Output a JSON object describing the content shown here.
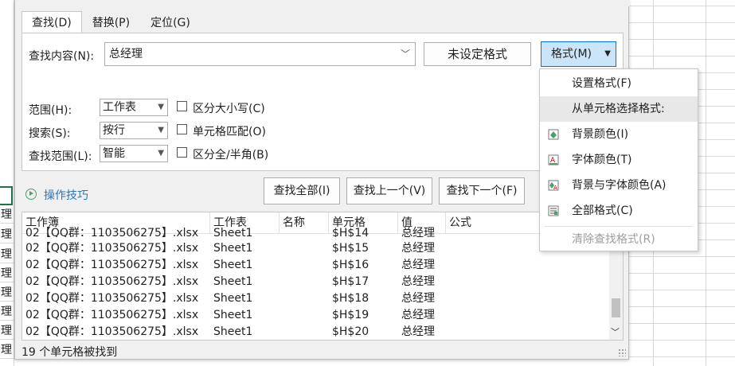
{
  "sheet": {
    "left_cells": [
      "理",
      "理",
      "理",
      "理",
      "理",
      "理",
      "理",
      "理",
      "理"
    ]
  },
  "tabs": [
    {
      "label": "查找(D)"
    },
    {
      "label": "替换(P)"
    },
    {
      "label": "定位(G)"
    }
  ],
  "find": {
    "label": "查找内容(N):",
    "value": "总经理",
    "format_status": "未设定格式",
    "format_button": "格式(M)"
  },
  "options": {
    "scope_label": "范围(H):",
    "scope_value": "工作表",
    "search_label": "搜索(S):",
    "search_value": "按行",
    "lookin_label": "查找范围(L):",
    "lookin_value": "智能",
    "match_case": "区分大小写(C)",
    "match_cell": "单元格匹配(O)",
    "match_width": "区分全/半角(B)"
  },
  "tips_link": "操作技巧",
  "actions": {
    "find_all": "查找全部(I)",
    "find_prev": "查找上一个(V)",
    "find_next": "查找下一个(F)"
  },
  "results": {
    "headers": [
      "工作簿",
      "工作表",
      "名称",
      "单元格",
      "值",
      "公式"
    ],
    "partial_row": {
      "book": "02【QQ群：1103506275】.xlsx",
      "sheet": "Sheet1",
      "cell": "$H$14",
      "value": "总经理"
    },
    "rows": [
      {
        "book": "02【QQ群：1103506275】.xlsx",
        "sheet": "Sheet1",
        "cell": "$H$15",
        "value": "总经理"
      },
      {
        "book": "02【QQ群：1103506275】.xlsx",
        "sheet": "Sheet1",
        "cell": "$H$16",
        "value": "总经理"
      },
      {
        "book": "02【QQ群：1103506275】.xlsx",
        "sheet": "Sheet1",
        "cell": "$H$17",
        "value": "总经理"
      },
      {
        "book": "02【QQ群：1103506275】.xlsx",
        "sheet": "Sheet1",
        "cell": "$H$18",
        "value": "总经理"
      },
      {
        "book": "02【QQ群：1103506275】.xlsx",
        "sheet": "Sheet1",
        "cell": "$H$19",
        "value": "总经理"
      },
      {
        "book": "02【QQ群：1103506275】.xlsx",
        "sheet": "Sheet1",
        "cell": "$H$20",
        "value": "总经理"
      }
    ]
  },
  "status": "19 个单元格被找到",
  "menu": {
    "items": [
      {
        "label": "设置格式(F)"
      },
      {
        "label": "从单元格选择格式:"
      },
      {
        "label": "背景颜色(I)"
      },
      {
        "label": "字体颜色(T)"
      },
      {
        "label": "背景与字体颜色(A)"
      },
      {
        "label": "全部格式(C)"
      },
      {
        "label": "清除查找格式(R)"
      }
    ]
  },
  "colors": {
    "accent": "#cce4f7",
    "accent_border": "#0078d7",
    "tips_link": "#2e75b6",
    "sheet_selection": "#217346"
  }
}
